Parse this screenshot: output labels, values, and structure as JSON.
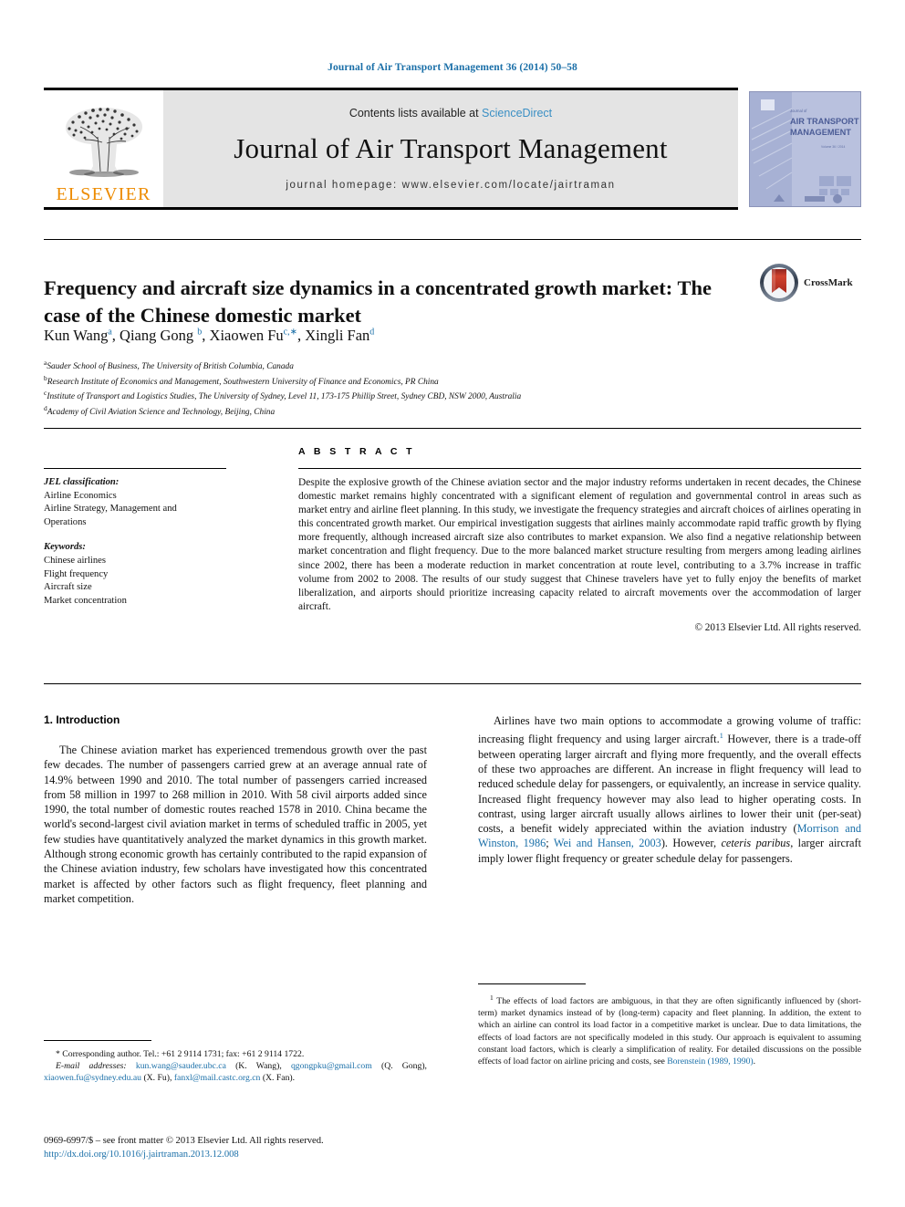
{
  "running_head": "Journal of Air Transport Management 36 (2014) 50–58",
  "masthead": {
    "publisher": "ELSEVIER",
    "contents_prefix": "Contents lists available at ",
    "contents_link": "ScienceDirect",
    "journal_name": "Journal of Air Transport Management",
    "homepage": "journal homepage: www.elsevier.com/locate/jairtraman"
  },
  "cover": {
    "line1": "Journal of",
    "line2": "AIR TRANSPORT",
    "line3": "MANAGEMENT"
  },
  "crossmark": {
    "label": "CrossMark"
  },
  "article": {
    "title": "Frequency and aircraft size dynamics in a concentrated growth market: The case of the Chinese domestic market",
    "authors_html": "Kun Wang<sup>a</sup>, Qiang Gong <sup>b</sup>, Xiaowen Fu<sup>c,∗</sup>, Xingli Fan<sup>d</sup>",
    "affiliations": [
      {
        "marker": "a",
        "text": "Sauder School of Business, The University of British Columbia, Canada"
      },
      {
        "marker": "b",
        "text": "Research Institute of Economics and Management, Southwestern University of Finance and Economics, PR China"
      },
      {
        "marker": "c",
        "text": "Institute of Transport and Logistics Studies, The University of Sydney, Level 11, 173-175 Phillip Street, Sydney CBD, NSW 2000, Australia"
      },
      {
        "marker": "d",
        "text": "Academy of Civil Aviation Science and Technology, Beijing, China"
      }
    ]
  },
  "info": {
    "abstract_heading": "A B S T R A C T",
    "jel_heading": "JEL classification:",
    "jel_items": [
      "Airline Economics",
      "Airline Strategy, Management and",
      "Operations"
    ],
    "keywords_heading": "Keywords:",
    "keywords": [
      "Chinese airlines",
      "Flight frequency",
      "Aircraft size",
      "Market concentration"
    ],
    "abstract": "Despite the explosive growth of the Chinese aviation sector and the major industry reforms undertaken in recent decades, the Chinese domestic market remains highly concentrated with a significant element of regulation and governmental control in areas such as market entry and airline fleet planning. In this study, we investigate the frequency strategies and aircraft choices of airlines operating in this concentrated growth market. Our empirical investigation suggests that airlines mainly accommodate rapid traffic growth by flying more frequently, although increased aircraft size also contributes to market expansion. We also find a negative relationship between market concentration and flight frequency. Due to the more balanced market structure resulting from mergers among leading airlines since 2002, there has been a moderate reduction in market concentration at route level, contributing to a 3.7% increase in traffic volume from 2002 to 2008. The results of our study suggest that Chinese travelers have yet to fully enjoy the benefits of market liberalization, and airports should prioritize increasing capacity related to aircraft movements over the accommodation of larger aircraft.",
    "copyright": "© 2013 Elsevier Ltd. All rights reserved."
  },
  "body": {
    "section_number_title": "1. Introduction",
    "left_paragraph": "The Chinese aviation market has experienced tremendous growth over the past few decades. The number of passengers carried grew at an average annual rate of 14.9% between 1990 and 2010. The total number of passengers carried increased from 58 million in 1997 to 268 million in 2010. With 58 civil airports added since 1990, the total number of domestic routes reached 1578 in 2010. China became the world's second-largest civil aviation market in terms of scheduled traffic in 2005, yet few studies have quantitatively analyzed the market dynamics in this growth market. Although strong economic growth has certainly contributed to the rapid expansion of the Chinese aviation industry, few scholars have investigated how this concentrated market is affected by other factors such as flight frequency, fleet planning and market competition.",
    "right_paragraph_part1": "Airlines have two main options to accommodate a growing volume of traffic: increasing flight frequency and using larger aircraft.",
    "right_footnote_marker": "1",
    "right_paragraph_part2": " However, there is a trade-off between operating larger aircraft and flying more frequently, and the overall effects of these two approaches are different. An increase in flight frequency will lead to reduced schedule delay for passengers, or equivalently, an increase in service quality. Increased flight frequency however may also lead to higher operating costs. In contrast, using larger aircraft usually allows airlines to lower their unit (per-seat) costs, a benefit widely appreciated within the aviation industry (",
    "right_cite_1": "Morrison and Winston, 1986",
    "right_sep_1": "; ",
    "right_cite_2": "Wei and Hansen, 2003",
    "right_paragraph_part3": "). However, ",
    "right_italic": "ceteris paribus",
    "right_paragraph_part4": ", larger aircraft imply lower flight frequency or greater schedule delay for passengers."
  },
  "footnotes": {
    "right_marker": "1",
    "right_text_part1": " The effects of load factors are ambiguous, in that they are often significantly influenced by (short-term) market dynamics instead of by (long-term) capacity and fleet planning. In addition, the extent to which an airline can control its load factor in a competitive market is unclear. Due to data limitations, the effects of load factors are not specifically modeled in this study. Our approach is equivalent to assuming constant load factors, which is clearly a simplification of reality. For detailed discussions on the possible effects of load factor on airline pricing and costs, see ",
    "right_cite": "Borenstein (1989, 1990)",
    "right_text_part2": ".",
    "left_corresponding": "* Corresponding author. Tel.: +61 2 9114 1731; fax: +61 2 9114 1722.",
    "left_email_label": "E-mail addresses:",
    "emails": [
      {
        "address": "kun.wang@sauder.ubc.ca",
        "owner": " (K. Wang), "
      },
      {
        "address": "qgongpku@gmail.com",
        "owner": " (Q. Gong), "
      },
      {
        "address": "xiaowen.fu@sydney.edu.au",
        "owner": " (X. Fu), "
      },
      {
        "address": "fanxl@mail.castc.org.cn",
        "owner": " (X. Fan)."
      }
    ]
  },
  "issn": {
    "line1": "0969-6997/$ – see front matter © 2013 Elsevier Ltd. All rights reserved.",
    "doi": "http://dx.doi.org/10.1016/j.jairtraman.2013.12.008"
  },
  "colors": {
    "link": "#1a6fa8",
    "elsevier_orange": "#ED8B00",
    "masthead_grey": "#e4e4e4",
    "crossmark_red": "#c0392b"
  }
}
